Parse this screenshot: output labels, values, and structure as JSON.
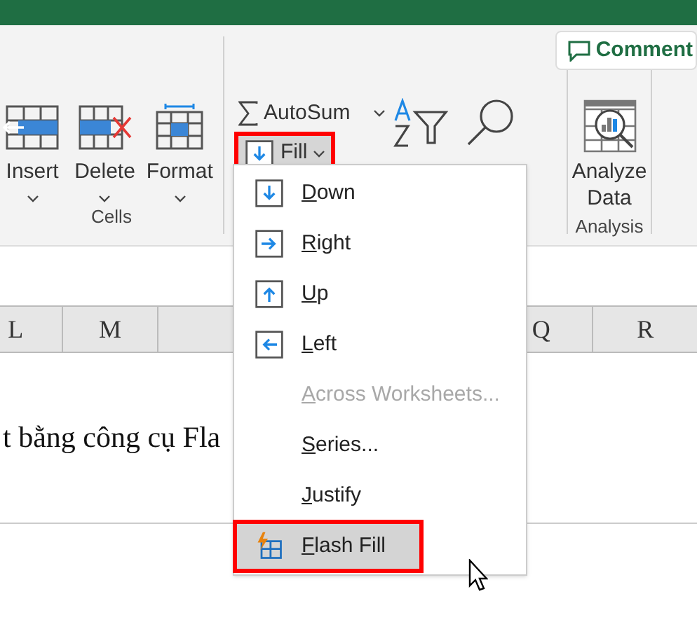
{
  "ribbon": {
    "comment_button": "Comment",
    "cells_group": {
      "label": "Cells",
      "buttons": [
        "Insert",
        "Delete",
        "Format"
      ]
    },
    "editing_group": {
      "autosum": "AutoSum",
      "fill": {
        "label": "Fill",
        "highlighted": true
      }
    },
    "analysis_group": {
      "label": "Analysis",
      "button": [
        "Analyze",
        "Data"
      ]
    }
  },
  "sheet": {
    "columns": [
      "L",
      "M",
      "Q",
      "R"
    ],
    "cell_text": "t bằng công cụ Fla"
  },
  "fill_menu": [
    {
      "label": "Down",
      "kind": "down",
      "disabled": false,
      "selected": false
    },
    {
      "label": "Right",
      "kind": "right",
      "disabled": false,
      "selected": false
    },
    {
      "label": "Up",
      "kind": "up",
      "disabled": false,
      "selected": false
    },
    {
      "label": "Left",
      "kind": "left",
      "disabled": false,
      "selected": false
    },
    {
      "label": "Across Worksheets...",
      "kind": "none",
      "disabled": true,
      "selected": false
    },
    {
      "label": "Series...",
      "kind": "none",
      "disabled": false,
      "selected": false
    },
    {
      "label": "Justify",
      "kind": "none",
      "disabled": false,
      "selected": false
    },
    {
      "label": "Flash Fill",
      "kind": "flash",
      "disabled": false,
      "selected": true,
      "highlighted": true
    }
  ]
}
